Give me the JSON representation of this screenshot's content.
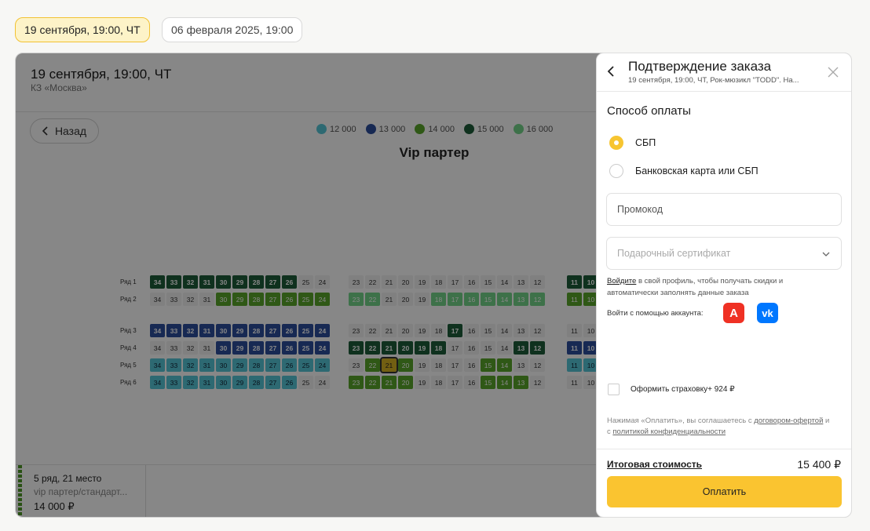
{
  "dates": {
    "active": "19 сентября, 19:00, ЧТ",
    "other": "06 февраля 2025, 19:00"
  },
  "event": {
    "title": "19 сентября, 19:00, ЧТ",
    "venue": "КЗ «Москва»"
  },
  "hall": {
    "back_label": "Назад",
    "section_title": "Vip партер",
    "legend": [
      {
        "label": "12 000",
        "color": "#56c6d8"
      },
      {
        "label": "13 000",
        "color": "#2d4e9e"
      },
      {
        "label": "14 000",
        "color": "#5aa62b"
      },
      {
        "label": "15 000",
        "color": "#1e5e3a"
      },
      {
        "label": "16 000",
        "color": "#74d68a"
      }
    ],
    "rows": [
      {
        "label": "Ряд 1",
        "left": [
          "c4",
          "c4",
          "c4",
          "c4",
          "c4",
          "c4",
          "c4",
          "c4",
          "c4",
          0,
          0
        ],
        "mid": [
          0,
          0,
          0,
          0,
          0,
          0,
          0,
          0,
          0,
          0,
          0,
          0
        ],
        "right": [
          "c4",
          "c4"
        ]
      },
      {
        "label": "Ряд 2",
        "left": [
          0,
          0,
          0,
          0,
          "c3",
          "c3",
          "c3",
          "c3",
          "c3",
          "c3",
          "c3"
        ],
        "mid": [
          "c5",
          "c5",
          0,
          0,
          0,
          "c5",
          "c5",
          "c5",
          "c5",
          "c5",
          "c5",
          "c5"
        ],
        "right": [
          "c3",
          "c3"
        ]
      },
      {
        "label": "Ряд 3",
        "left": [
          "c2",
          "c2",
          "c2",
          "c2",
          "c2",
          "c2",
          "c2",
          "c2",
          "c2",
          "c2",
          "c2"
        ],
        "mid": [
          0,
          0,
          0,
          0,
          0,
          0,
          "c4",
          0,
          0,
          0,
          0,
          0
        ],
        "right": [
          0,
          0
        ]
      },
      {
        "label": "Ряд 4",
        "left": [
          0,
          0,
          0,
          0,
          "c2",
          "c2",
          "c2",
          "c2",
          "c2",
          "c2",
          "c2"
        ],
        "mid": [
          "c4",
          "c4",
          "c4",
          "c4",
          "c4",
          "c4",
          0,
          0,
          0,
          0,
          "c4",
          "c4"
        ],
        "right": [
          "c2",
          "c2"
        ]
      },
      {
        "label": "Ряд 5",
        "left": [
          "c1",
          "c1",
          "c1",
          "c1",
          "c1",
          "c1",
          "c1",
          "c1",
          "c1",
          "c1",
          "c1"
        ],
        "mid": [
          0,
          "c3",
          "sel",
          "c3",
          0,
          0,
          0,
          0,
          "c3",
          "c3",
          0,
          0
        ],
        "right": [
          "c1",
          "c1"
        ]
      },
      {
        "label": "Ряд 6",
        "left": [
          "c1",
          "c1",
          "c1",
          "c1",
          "c1",
          "c1",
          "c1",
          "c1",
          "c1",
          0,
          0
        ],
        "mid": [
          "c3",
          "c3",
          "c3",
          "c3",
          0,
          0,
          0,
          0,
          "c3",
          "c3",
          "c3",
          0
        ],
        "right": [
          0,
          0
        ]
      }
    ],
    "left_numbers": [
      "34",
      "33",
      "32",
      "31",
      "30",
      "29",
      "28",
      "27",
      "26",
      "25",
      "24"
    ],
    "mid_numbers": [
      "23",
      "22",
      "21",
      "20",
      "19",
      "18",
      "17",
      "16",
      "15",
      "14",
      "13",
      "12"
    ],
    "right_numbers": [
      "11",
      "10"
    ]
  },
  "ticket": {
    "place": "5 ряд, 21 место",
    "category": "vip партер/стандарт...",
    "price": "14 000 ₽"
  },
  "panel": {
    "title": "Подтверждение заказа",
    "subtitle": "19 сентября, 19:00, ЧТ, Рок-мюзикл \"TODD\". На...",
    "payment_heading": "Способ оплаты",
    "payment_options": [
      "СБП",
      "Банковская карта или СБП"
    ],
    "promo_placeholder": "Промокод",
    "gift_placeholder": "Подарочный сертификат",
    "login_link": "Войдите",
    "login_text": " в свой профиль, чтобы получать скидки и автоматически заполнять данные заказа",
    "social_label": "Войти с помощью аккаунта:",
    "insurance_label": "Оформить страховку+ 924 ₽",
    "terms_text": "Нажимая «Оплатить», вы соглашаетесь с ",
    "terms_link": "договором-офертой",
    "terms_mid": " и с ",
    "privacy_link": "политикой конфиденциальности",
    "total_label": "Итоговая стоимость",
    "total_value": "15 400 ₽",
    "pay_label": "Оплатить"
  }
}
